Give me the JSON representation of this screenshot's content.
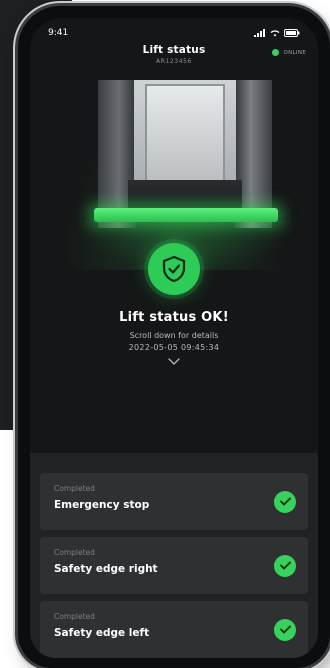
{
  "colors": {
    "accent": "#35d35b",
    "screen_bg": "#151617",
    "card_bg": "#2e3032"
  },
  "status_bar": {
    "time": "9:41"
  },
  "header": {
    "title": "Lift status",
    "subtitle": "AR123456",
    "online_label": "ONLINE"
  },
  "status": {
    "icon": "shield-check-icon",
    "title": "Lift status OK!",
    "subtitle": "Scroll down for details",
    "timestamp": "2022-05-05 09:45:34"
  },
  "checks": [
    {
      "label": "Completed",
      "title": "Emergency stop",
      "icon": "check-icon"
    },
    {
      "label": "Completed",
      "title": "Safety edge right",
      "icon": "check-icon"
    },
    {
      "label": "Completed",
      "title": "Safety edge left",
      "icon": "check-icon"
    }
  ]
}
